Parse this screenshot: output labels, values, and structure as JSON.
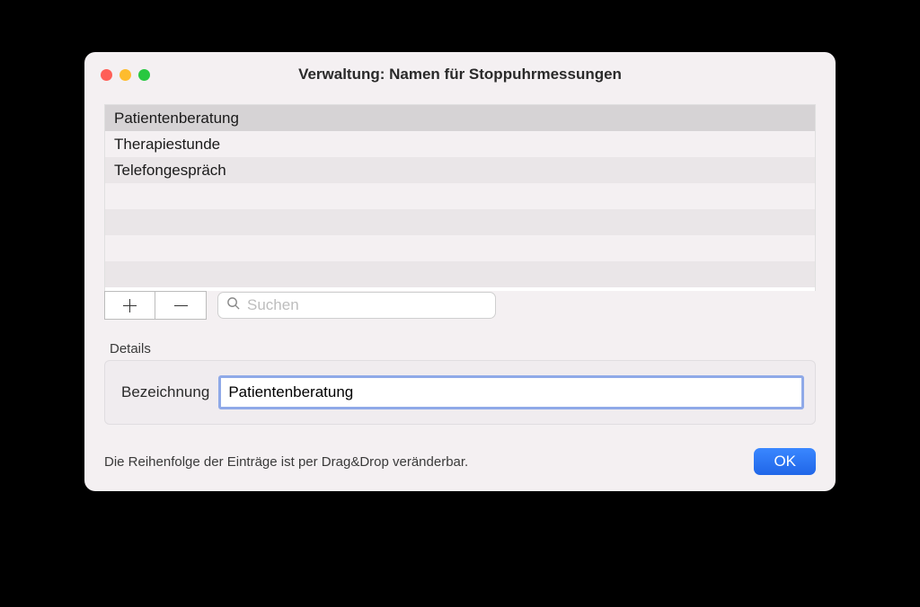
{
  "window": {
    "title": "Verwaltung: Namen für Stoppuhrmessungen"
  },
  "list": {
    "items": [
      "Patientenberatung",
      "Therapiestunde",
      "Telefongespräch"
    ],
    "selectedIndex": 0
  },
  "toolbar": {
    "search_placeholder": "Suchen"
  },
  "details": {
    "section_label": "Details",
    "field_label": "Bezeichnung",
    "field_value": "Patientenberatung"
  },
  "footer": {
    "hint": "Die Reihenfolge der Einträge ist per Drag&Drop veränderbar.",
    "ok_label": "OK"
  }
}
